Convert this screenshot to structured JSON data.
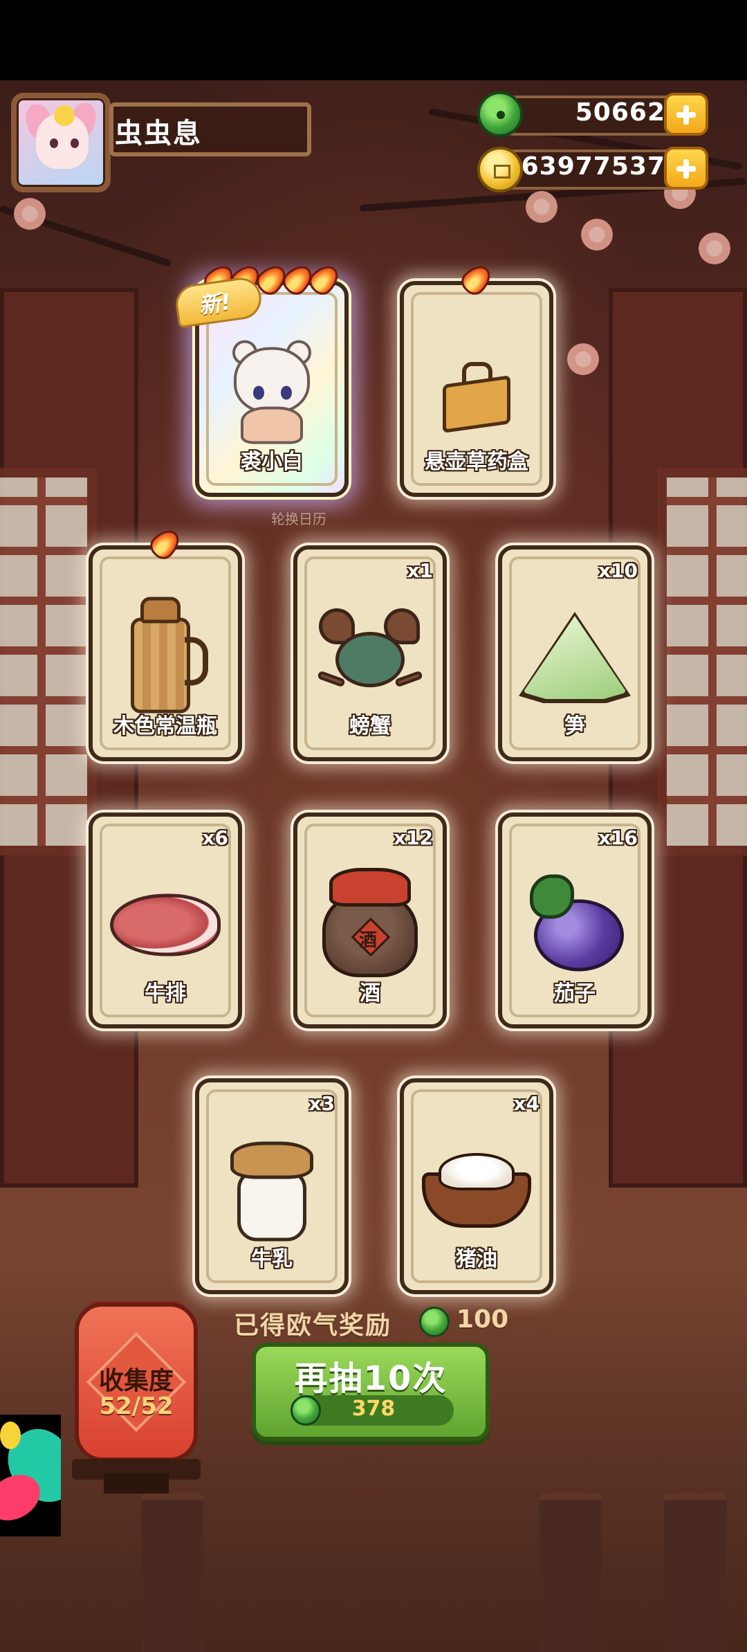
{
  "player": {
    "name": "虫虫息"
  },
  "currencies": [
    {
      "type": "jade",
      "value": "50662"
    },
    {
      "type": "coin",
      "value": "63977537"
    }
  ],
  "scene_label": "轮换日历",
  "badge_new": "新!",
  "cards": [
    {
      "label": "裘小白",
      "qty": "",
      "flames": 5,
      "rainbow": true,
      "new": true,
      "icon": "white-cat-icon"
    },
    {
      "label": "悬壶草药盒",
      "qty": "",
      "flames": 1,
      "rainbow": false,
      "new": false,
      "icon": "herb-box-icon"
    },
    {
      "label": "木色常温瓶",
      "qty": "",
      "flames": 1,
      "rainbow": false,
      "new": false,
      "icon": "thermos-icon"
    },
    {
      "label": "螃蟹",
      "qty": "x1",
      "flames": 0,
      "rainbow": false,
      "new": false,
      "icon": "crab-icon"
    },
    {
      "label": "笋",
      "qty": "x10",
      "flames": 0,
      "rainbow": false,
      "new": false,
      "icon": "bamboo-shoot-icon"
    },
    {
      "label": "牛排",
      "qty": "x6",
      "flames": 0,
      "rainbow": false,
      "new": false,
      "icon": "steak-icon"
    },
    {
      "label": "酒",
      "qty": "x12",
      "flames": 0,
      "rainbow": false,
      "new": false,
      "icon": "wine-jar-icon"
    },
    {
      "label": "茄子",
      "qty": "x16",
      "flames": 0,
      "rainbow": false,
      "new": false,
      "icon": "eggplant-icon"
    },
    {
      "label": "牛乳",
      "qty": "x3",
      "flames": 0,
      "rainbow": false,
      "new": false,
      "icon": "milk-jar-icon"
    },
    {
      "label": "猪油",
      "qty": "x4",
      "flames": 0,
      "rainbow": false,
      "new": false,
      "icon": "lard-bowl-icon"
    }
  ],
  "jar_character": "酒",
  "reward": {
    "label": "已得欧气奖励",
    "amount": "100"
  },
  "collection": {
    "title": "收集度",
    "value": "52/52"
  },
  "draw_button": {
    "label": "再抽10次",
    "cost": "378"
  },
  "colors": {
    "accent_green": "#5fa42f",
    "card_bg": "#efe2c2",
    "gold": "#f2c230"
  }
}
